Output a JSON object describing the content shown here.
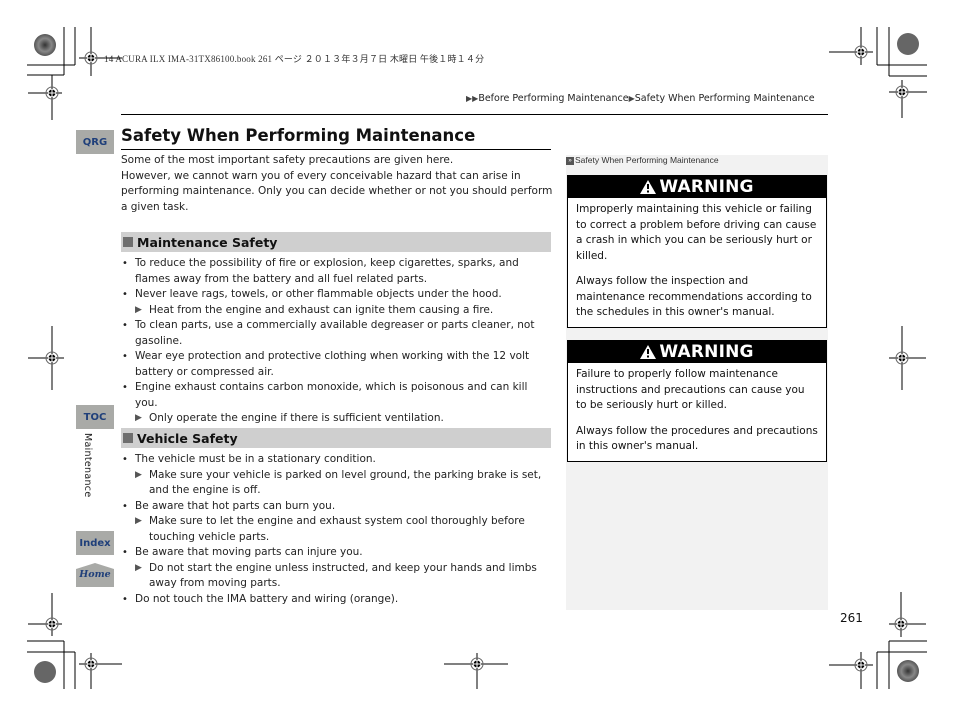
{
  "print_header": "14 ACURA ILX IMA-31TX86100.book  261 ページ  ２０１３年３月７日  木曜日  午後１時１４分",
  "breadcrumb": {
    "items": [
      "Before Performing Maintenance",
      "Safety When Performing Maintenance"
    ]
  },
  "nav": {
    "qrg": "QRG",
    "toc": "TOC",
    "index": "Index",
    "home": "Home",
    "section_label": "Maintenance"
  },
  "title": "Safety When Performing Maintenance",
  "intro": [
    "Some of the most important safety precautions are given here.",
    "However, we cannot warn you of every conceivable hazard that can arise in performing maintenance. Only you can decide whether or not you should perform a given task."
  ],
  "sections": [
    {
      "heading": "Maintenance Safety",
      "items": [
        {
          "type": "bullet",
          "text": "To reduce the possibility of fire or explosion, keep cigarettes, sparks, and flames away from the battery and all fuel related parts."
        },
        {
          "type": "bullet",
          "text": "Never leave rags, towels, or other flammable objects under the hood."
        },
        {
          "type": "sub",
          "text": "Heat from the engine and exhaust can ignite them causing a fire."
        },
        {
          "type": "bullet",
          "text": "To clean parts, use a commercially available degreaser or parts cleaner, not gasoline."
        },
        {
          "type": "bullet",
          "text": "Wear eye protection and protective clothing when working with the 12 volt battery or compressed air."
        },
        {
          "type": "bullet",
          "text": "Engine exhaust contains carbon monoxide, which is poisonous and can kill you."
        },
        {
          "type": "sub",
          "text": "Only operate the engine if there is sufficient ventilation."
        }
      ]
    },
    {
      "heading": "Vehicle Safety",
      "items": [
        {
          "type": "bullet",
          "text": "The vehicle must be in a stationary condition."
        },
        {
          "type": "sub",
          "text": "Make sure your vehicle is parked on level ground, the parking brake is set, and the engine is off."
        },
        {
          "type": "bullet",
          "text": "Be aware that hot parts can burn you."
        },
        {
          "type": "sub",
          "text": "Make sure to let the engine and exhaust system cool thoroughly before touching vehicle parts."
        },
        {
          "type": "bullet",
          "text": "Be aware that moving parts can injure you."
        },
        {
          "type": "sub",
          "text": "Do not start the engine unless instructed, and keep your hands and limbs away from moving parts."
        },
        {
          "type": "bullet",
          "text": "Do not touch the IMA battery and wiring (orange)."
        }
      ]
    }
  ],
  "sidebar": {
    "reference": "Safety When Performing Maintenance",
    "warnings": [
      {
        "label": "WARNING",
        "paragraphs": [
          "Improperly maintaining this vehicle or failing to correct a problem before driving can cause a crash in which you can be seriously hurt or killed.",
          "Always follow the inspection and maintenance recommendations according to the schedules in this owner's manual."
        ]
      },
      {
        "label": "WARNING",
        "paragraphs": [
          "Failure to properly follow maintenance instructions and precautions can cause you to be seriously hurt or killed.",
          "Always follow the procedures and precautions in this owner's manual."
        ]
      }
    ]
  },
  "page_number": "261",
  "colors": {
    "nav_button_bg": "#a9aaa7",
    "nav_button_text": "#1f3f7a",
    "section_head_bg": "#cfcfcf",
    "sidebar_bg": "#f2f2f2",
    "warning_head_bg": "#000000"
  }
}
